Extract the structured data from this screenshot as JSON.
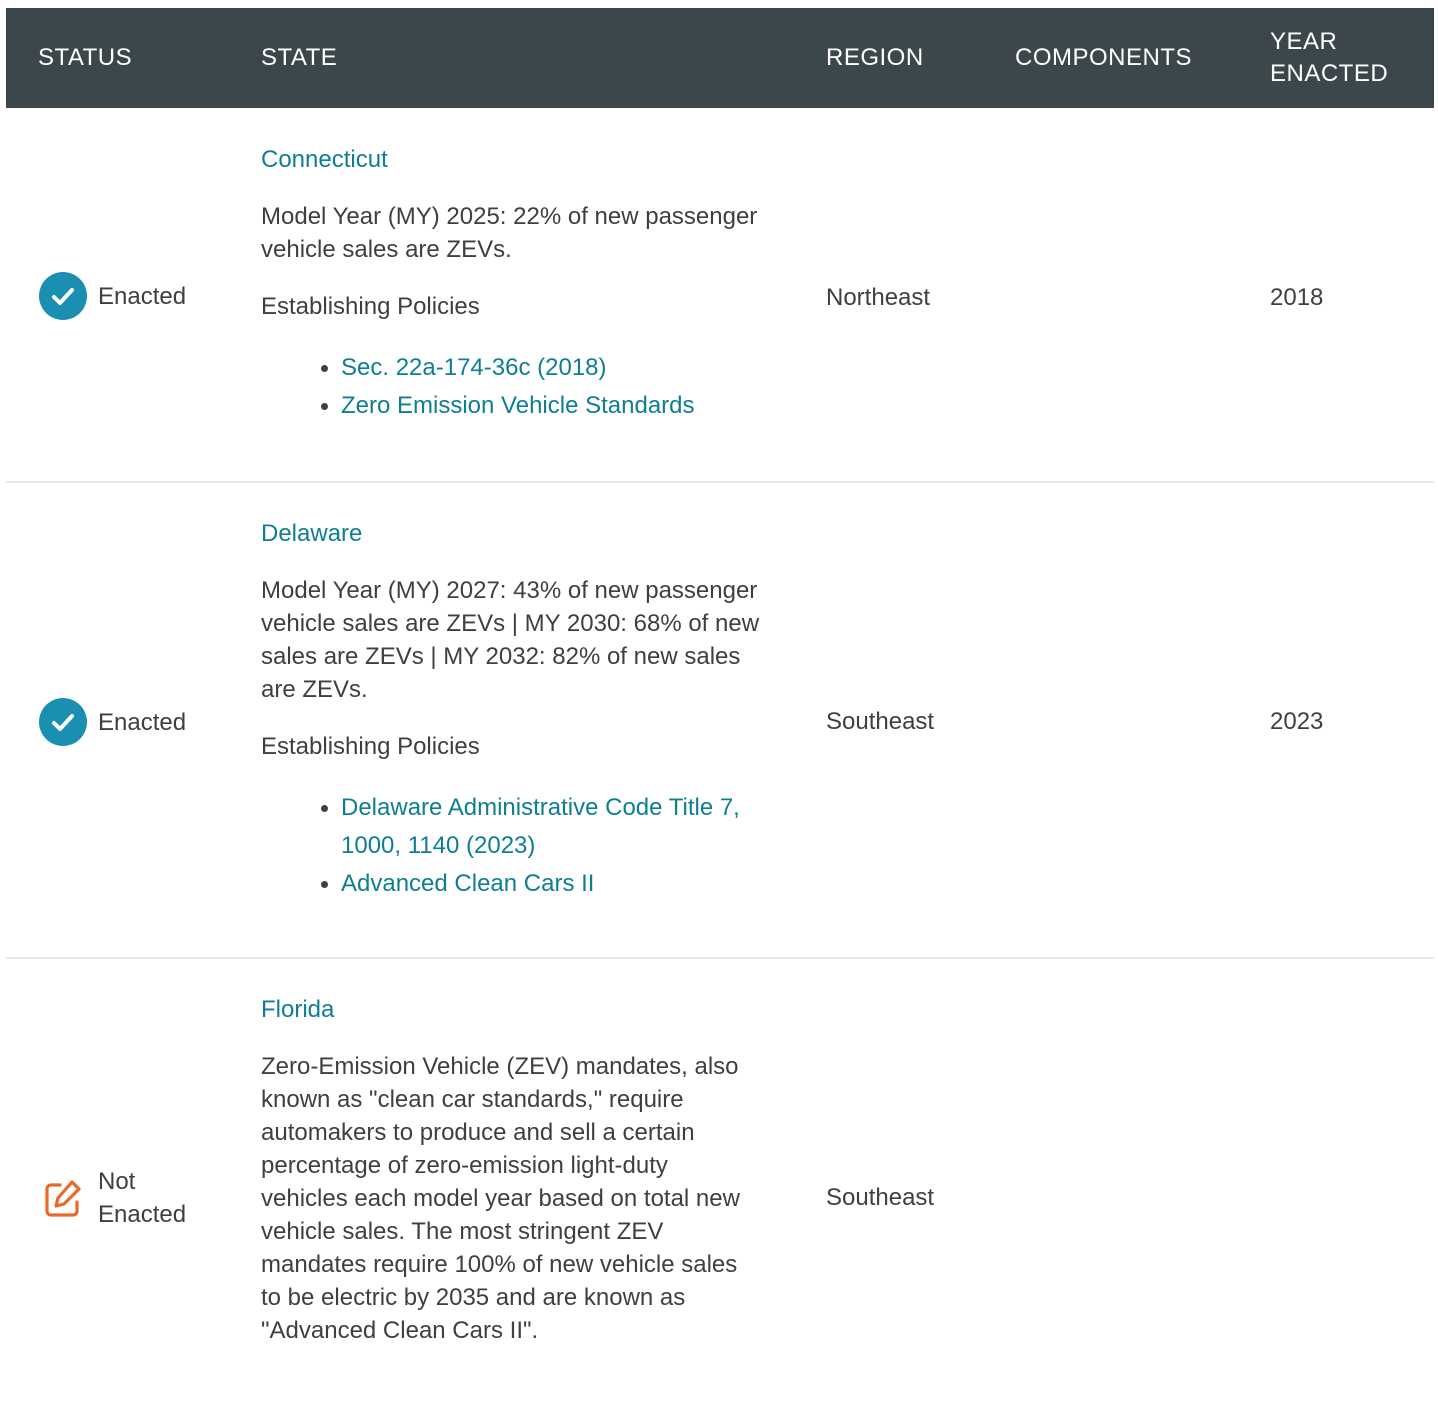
{
  "table": {
    "headers": {
      "status": "STATUS",
      "state": "STATE",
      "region": "REGION",
      "components": "COMPONENTS",
      "year_enacted": "YEAR\nENACTED"
    },
    "rows": [
      {
        "status": "Enacted",
        "status_icon": "check-circle-icon",
        "state": "Connecticut",
        "description": "Model Year (MY) 2025: 22% of new passenger vehicle sales are ZEVs.",
        "policies_heading": "Establishing Policies",
        "policies": [
          "Sec. 22a-174-36c (2018)",
          "Zero Emission Vehicle Standards"
        ],
        "region": "Northeast",
        "components": "",
        "year": "2018"
      },
      {
        "status": "Enacted",
        "status_icon": "check-circle-icon",
        "state": "Delaware",
        "description": "Model Year (MY) 2027: 43% of new passenger vehicle sales are ZEVs | MY 2030: 68% of new sales are ZEVs | MY 2032: 82% of new sales are ZEVs.",
        "policies_heading": "Establishing Policies",
        "policies": [
          "Delaware Administrative Code Title 7, 1000, 1140 (2023)",
          "Advanced Clean Cars II"
        ],
        "region": "Southeast",
        "components": "",
        "year": "2023"
      },
      {
        "status": "Not Enacted",
        "status_icon": "edit-icon",
        "state": "Florida",
        "description": "Zero-Emission Vehicle (ZEV) mandates, also known as \"clean car standards,\" require automakers to produce and sell a certain percentage of zero-emission light-duty vehicles each model year based on total new vehicle sales. The most stringent ZEV mandates require 100% of new vehicle sales to be electric by 2035 and are known as \"Advanced Clean Cars II\".",
        "region": "Southeast",
        "components": "",
        "year": ""
      }
    ]
  },
  "colors": {
    "header_bg": "#3c474c",
    "link": "#0f7e92",
    "enacted_icon": "#1a8fb2",
    "not_enacted_icon": "#e8692a",
    "divider": "#e3e8ea"
  }
}
